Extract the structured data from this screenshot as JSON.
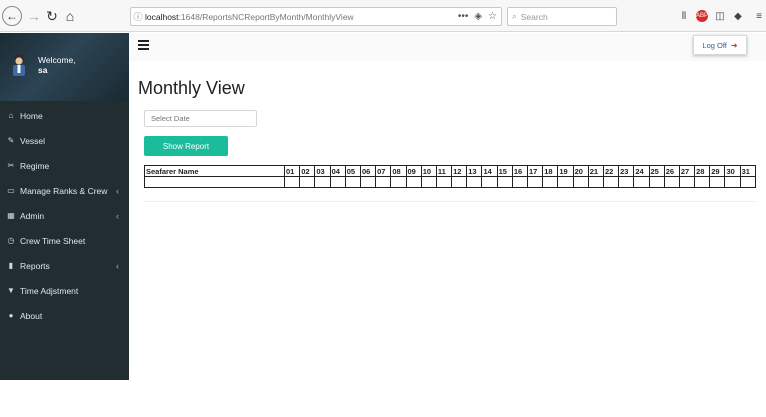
{
  "browser": {
    "url_host": "localhost",
    "url_path": ":1648/ReportsNCReportByMonth/MonthlyView",
    "search_placeholder": "Search"
  },
  "sidebar": {
    "welcome": "Welcome,",
    "username": "sa",
    "items": [
      {
        "label": "Home",
        "icon": "home-icon",
        "glyph": "⌂",
        "has_children": false
      },
      {
        "label": "Vessel",
        "icon": "edit-icon",
        "glyph": "✎",
        "has_children": false
      },
      {
        "label": "Regime",
        "icon": "scissors-icon",
        "glyph": "✂",
        "has_children": false
      },
      {
        "label": "Manage Ranks & Crew",
        "icon": "desktop-icon",
        "glyph": "▭",
        "has_children": true
      },
      {
        "label": "Admin",
        "icon": "table-icon",
        "glyph": "▦",
        "has_children": true
      },
      {
        "label": "Crew Time Sheet",
        "icon": "clock-icon",
        "glyph": "◷",
        "has_children": false
      },
      {
        "label": "Reports",
        "icon": "bar-chart-icon",
        "glyph": "▮",
        "has_children": true
      },
      {
        "label": "Time Adjstment",
        "icon": "filter-icon",
        "glyph": "▼",
        "has_children": false
      },
      {
        "label": "About",
        "icon": "user-icon",
        "glyph": "●",
        "has_children": false
      }
    ]
  },
  "header": {
    "logoff_label": "Log Off"
  },
  "main": {
    "title": "Monthly View",
    "date_placeholder": "Select Date",
    "show_report_label": "Show Report",
    "table": {
      "name_header": "Seafarer Name",
      "day_headers": [
        "01",
        "02",
        "03",
        "04",
        "05",
        "06",
        "07",
        "08",
        "09",
        "10",
        "11",
        "12",
        "13",
        "14",
        "15",
        "16",
        "17",
        "18",
        "19",
        "20",
        "21",
        "22",
        "23",
        "24",
        "25",
        "26",
        "27",
        "28",
        "29",
        "30",
        "31"
      ]
    }
  },
  "colors": {
    "sidebar_bg": "#222d32",
    "accent": "#1abc9c",
    "logoff_text": "#2f5f9a"
  }
}
